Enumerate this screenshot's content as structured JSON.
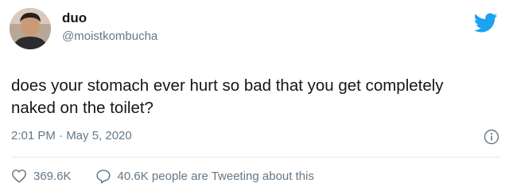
{
  "author": {
    "display_name": "duo",
    "handle": "@moistkombucha",
    "avatar_icon": "avatar-photo"
  },
  "tweet": {
    "text": "does your stomach ever hurt so bad that you get completely naked on the toilet?",
    "timestamp": "2:01 PM · May 5, 2020"
  },
  "stats": {
    "likes": "369.6K",
    "retweet_discussion": "40.6K people are Tweeting about this"
  },
  "icons": {
    "brand": "twitter-bird-icon",
    "info": "info-icon",
    "like": "heart-icon",
    "reply": "comment-bubble-icon"
  },
  "colors": {
    "brand_blue": "#1DA1F2",
    "text_primary": "#14171a",
    "text_secondary": "#657786",
    "divider": "#e1e8ed"
  }
}
